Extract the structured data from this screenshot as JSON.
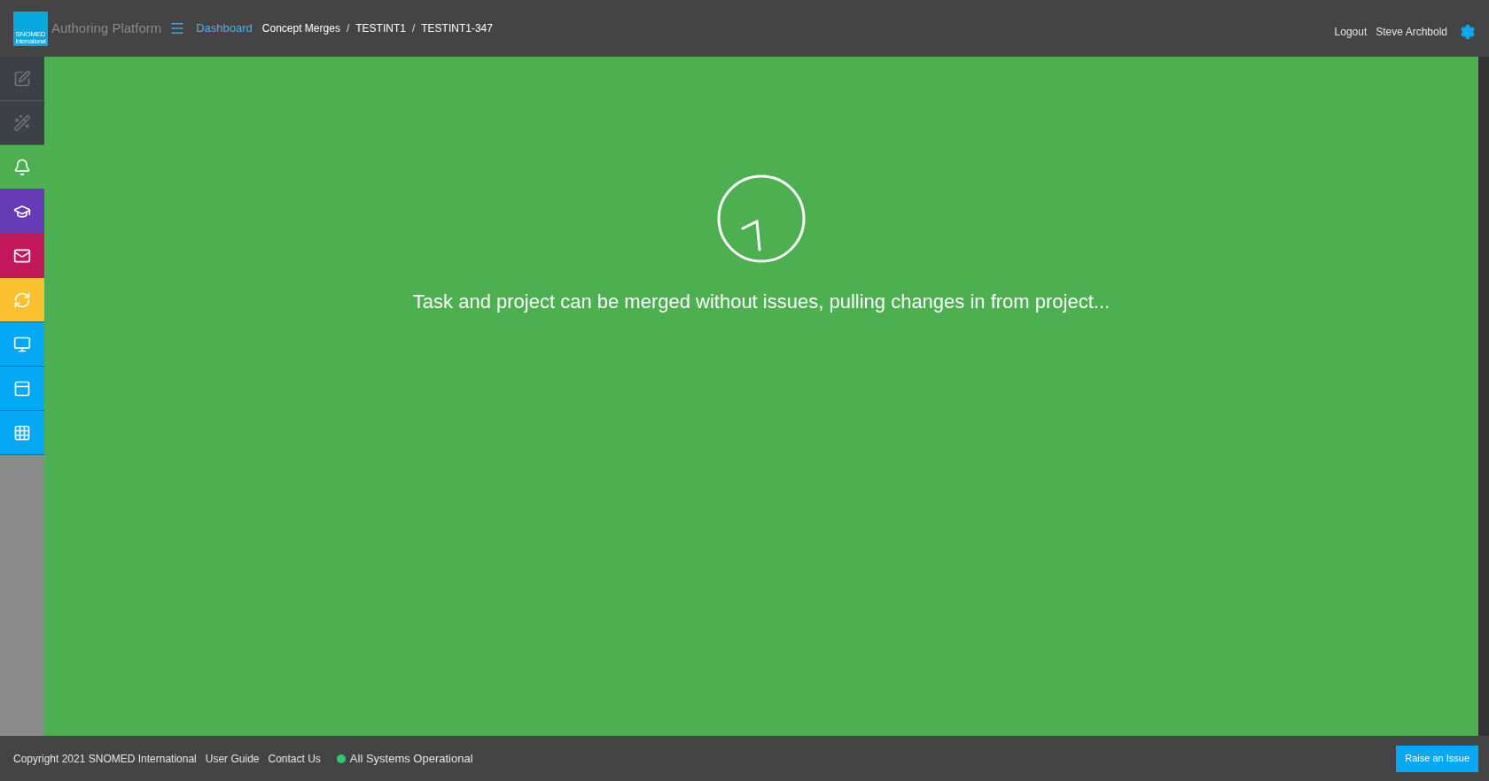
{
  "header": {
    "logo": {
      "line_1": "SNOMED",
      "line_2": "International"
    },
    "app_name": "Authoring Platform",
    "separator": "/",
    "breadcrumbs": [
      {
        "label": "Dashboard",
        "kind": "link"
      },
      {
        "label": "Concept Merges",
        "kind": "plain"
      },
      {
        "label": "TESTINT1",
        "kind": "plain"
      },
      {
        "label": "TESTINT1-347",
        "kind": "plain"
      }
    ],
    "logout": "Logout",
    "user": "Steve Archbold"
  },
  "sidebar": {
    "items": [
      {
        "color": "#3f4047"
      },
      {
        "color": "#3f4047"
      },
      {
        "color": "#4caf50"
      },
      {
        "color": "#673ab7"
      },
      {
        "color": "#c2185b"
      },
      {
        "color": "#fbc02d"
      },
      {
        "color": "#03a9f4"
      },
      {
        "color": "#03a9f4"
      },
      {
        "color": "#03a9f4"
      }
    ]
  },
  "main": {
    "message": "Task and project can be merged without issues, pulling changes in from project..."
  },
  "footer": {
    "copyright": "Copyright 2021 SNOMED International",
    "links": [
      "User Guide",
      "Contact Us"
    ],
    "status": {
      "label": "All Systems Operational",
      "color": "#2ecc71"
    },
    "raise_button": "Raise an Issue"
  }
}
